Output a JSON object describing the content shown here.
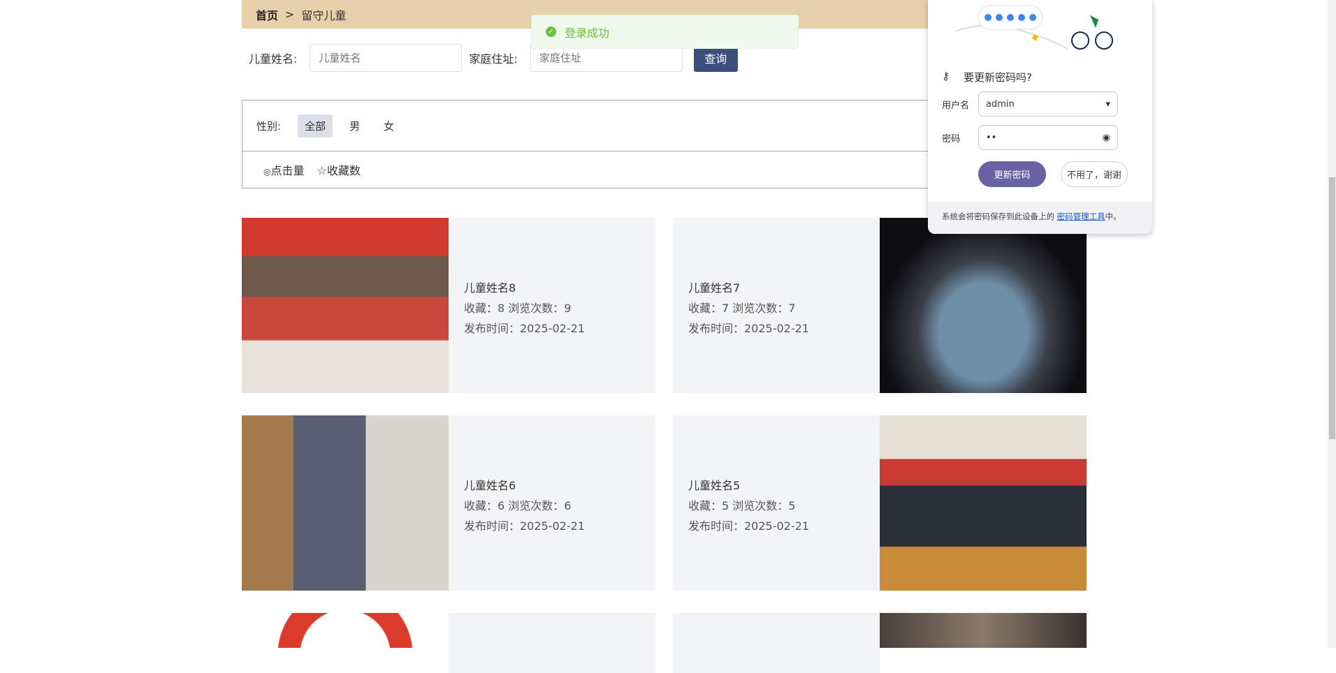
{
  "breadcrumb": {
    "home": "首页",
    "sep": ">",
    "current": "留守儿童"
  },
  "search": {
    "name_label": "儿童姓名:",
    "name_placeholder": "儿童姓名",
    "name_value": "",
    "addr_label": "家庭住址:",
    "addr_placeholder": "家庭住址",
    "addr_value": "",
    "query_button": "查询"
  },
  "filter": {
    "label": "性别:",
    "options": [
      "全部",
      "男",
      "女"
    ],
    "selected": "全部"
  },
  "sort": {
    "clicks": "点击量",
    "favorites": "收藏数"
  },
  "cards": [
    {
      "name": "儿童姓名8",
      "stats": "收藏：8  浏览次数：9",
      "date": "发布时间：2025-02-21"
    },
    {
      "name": "儿童姓名7",
      "stats": "收藏：7  浏览次数：7",
      "date": "发布时间：2025-02-21"
    },
    {
      "name": "儿童姓名6",
      "stats": "收藏：6  浏览次数：6",
      "date": "发布时间：2025-02-21"
    },
    {
      "name": "儿童姓名5",
      "stats": "收藏：5  浏览次数：5",
      "date": "发布时间：2025-02-21"
    }
  ],
  "toast": {
    "message": "登录成功",
    "color": "#67c23a"
  },
  "password_popup": {
    "title": "要更新密码吗?",
    "username_label": "用户名",
    "username": "admin",
    "password_label": "密码",
    "password": "••",
    "update_button": "更新密码",
    "decline_button": "不用了，谢谢",
    "footer_text": "系统会将密码保存到此设备上的 ",
    "footer_link": "密码管理工具",
    "footer_end": "中。"
  }
}
